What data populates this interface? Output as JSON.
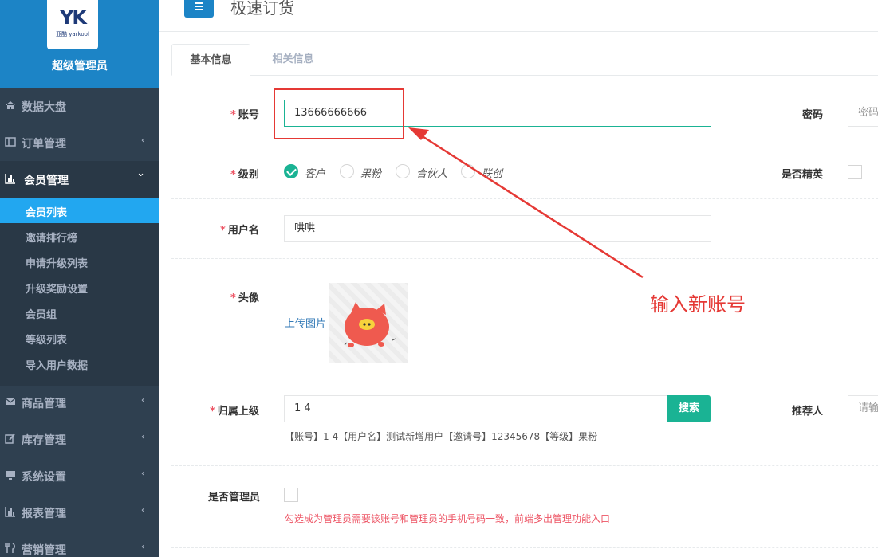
{
  "brand": {
    "logo_mark": "YK",
    "logo_sub": "亚酷 yarkool",
    "role": "超级管理员"
  },
  "sidebar": {
    "items": [
      {
        "label": "数据大盘",
        "icon": "home-icon"
      },
      {
        "label": "订单管理",
        "icon": "order-icon",
        "chevron": "‹"
      },
      {
        "label": "会员管理",
        "icon": "bar-chart-icon",
        "chevron": "⌄"
      },
      {
        "label": "商品管理",
        "icon": "envelope-icon",
        "chevron": "‹"
      },
      {
        "label": "库存管理",
        "icon": "edit-icon",
        "chevron": "‹"
      },
      {
        "label": "系统设置",
        "icon": "monitor-icon",
        "chevron": "‹"
      },
      {
        "label": "报表管理",
        "icon": "bar-chart-icon",
        "chevron": "‹"
      },
      {
        "label": "营销管理",
        "icon": "cutlery-icon",
        "chevron": "‹"
      }
    ],
    "submenu": [
      "会员列表",
      "邀请排行榜",
      "申请升级列表",
      "升级奖励设置",
      "会员组",
      "等级列表",
      "导入用户数据"
    ]
  },
  "header": {
    "menu_icon": "≡",
    "title": "极速订货"
  },
  "tabs": [
    "基本信息",
    "相关信息"
  ],
  "form": {
    "required_mark": "*",
    "account": {
      "label": "账号",
      "value": "13666666666"
    },
    "password": {
      "label": "密码",
      "placeholder": "密码"
    },
    "level": {
      "label": "级别",
      "options": [
        "客户",
        "果粉",
        "合伙人",
        "联创"
      ],
      "selected": "客户"
    },
    "elite": {
      "label": "是否精英"
    },
    "username": {
      "label": "用户名",
      "value": "哄哄"
    },
    "avatar": {
      "label": "头像",
      "upload_link": "上传图片"
    },
    "parent": {
      "label": "归属上级",
      "value": "1           4",
      "search_label": "搜索",
      "info": "【账号】1             4【用户名】测试新增用户【邀请号】12345678【等级】果粉"
    },
    "referrer": {
      "label": "推荐人",
      "placeholder": "请输"
    },
    "is_admin": {
      "label": "是否管理员",
      "hint": "勾选成为管理员需要该账号和管理员的手机号码一致，前端多出管理功能入口"
    }
  },
  "annotation": {
    "text": "输入新账号",
    "color": "#e53935"
  },
  "colors": {
    "sidebar": "#2f4050",
    "brand": "#1c84c6",
    "active_sub": "#22a7f0",
    "primary": "#1ab394",
    "required": "#ed5565"
  }
}
